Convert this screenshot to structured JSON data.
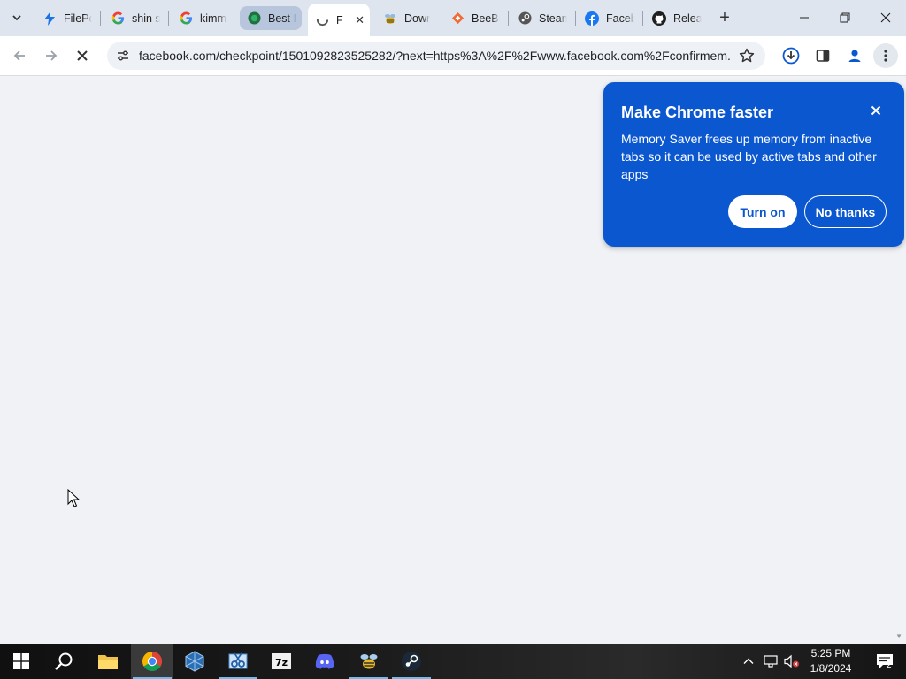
{
  "tabs": [
    {
      "title": "FilePo",
      "icon": "filepond-icon"
    },
    {
      "title": "shin s",
      "icon": "google-icon"
    },
    {
      "title": "kimm",
      "icon": "google-icon"
    },
    {
      "title": "Best I",
      "icon": "best-icon"
    },
    {
      "title": "F",
      "icon": "loading-icon"
    },
    {
      "title": "Dowr",
      "icon": "bee-icon"
    },
    {
      "title": "BeeBi",
      "icon": "beebit-icon"
    },
    {
      "title": "Stean",
      "icon": "steam-icon"
    },
    {
      "title": "Faceb",
      "icon": "facebook-icon"
    },
    {
      "title": "Relea",
      "icon": "github-icon"
    }
  ],
  "address_bar": {
    "url": "facebook.com/checkpoint/1501092823525282/?next=https%3A%2F%2Fwww.facebook.com%2Fconfirmem..."
  },
  "popup": {
    "title": "Make Chrome faster",
    "body": "Memory Saver frees up memory from inactive tabs so it can be used by active tabs and other apps",
    "turn_on": "Turn on",
    "no_thanks": "No thanks"
  },
  "taskbar": {
    "time": "5:25 PM",
    "date": "1/8/2024",
    "notification_count": "2"
  },
  "colors": {
    "accent": "#0b57d0",
    "page_bg": "#f0f2f5",
    "tabstrip_bg": "#dfe5ee"
  }
}
